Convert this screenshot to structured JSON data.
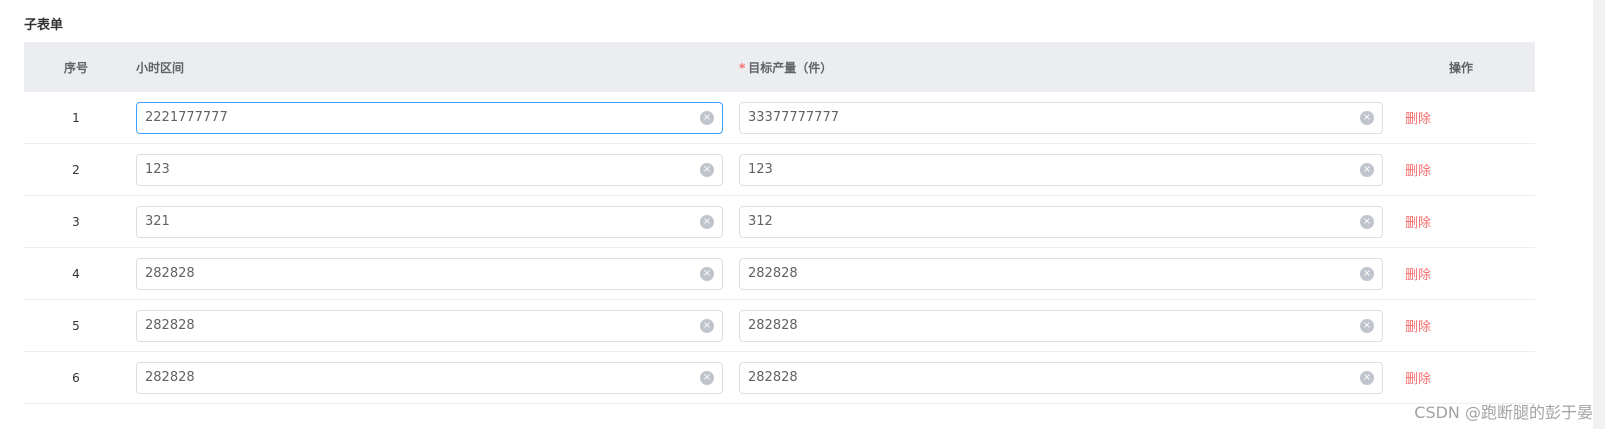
{
  "section": {
    "title": "子表单"
  },
  "table": {
    "headers": {
      "index": "序号",
      "hour_range": "小时区间",
      "required_mark": "*",
      "target_output": "目标产量（件）",
      "action": "操作"
    },
    "rows": [
      {
        "index": "1",
        "hour_range": "2221777777",
        "target_output": "33377777777",
        "delete_label": "删除"
      },
      {
        "index": "2",
        "hour_range": "123",
        "target_output": "123",
        "delete_label": "删除"
      },
      {
        "index": "3",
        "hour_range": "321",
        "target_output": "312",
        "delete_label": "删除"
      },
      {
        "index": "4",
        "hour_range": "282828",
        "target_output": "282828",
        "delete_label": "删除"
      },
      {
        "index": "5",
        "hour_range": "282828",
        "target_output": "282828",
        "delete_label": "删除"
      },
      {
        "index": "6",
        "hour_range": "282828",
        "target_output": "282828",
        "delete_label": "删除"
      }
    ]
  },
  "icons": {
    "clear": "clear-circle-icon"
  },
  "colors": {
    "danger": "#f56c6c",
    "focus_border": "#409eff",
    "header_bg": "#ebedf0"
  },
  "watermark": "CSDN @跑断腿的彭于晏"
}
